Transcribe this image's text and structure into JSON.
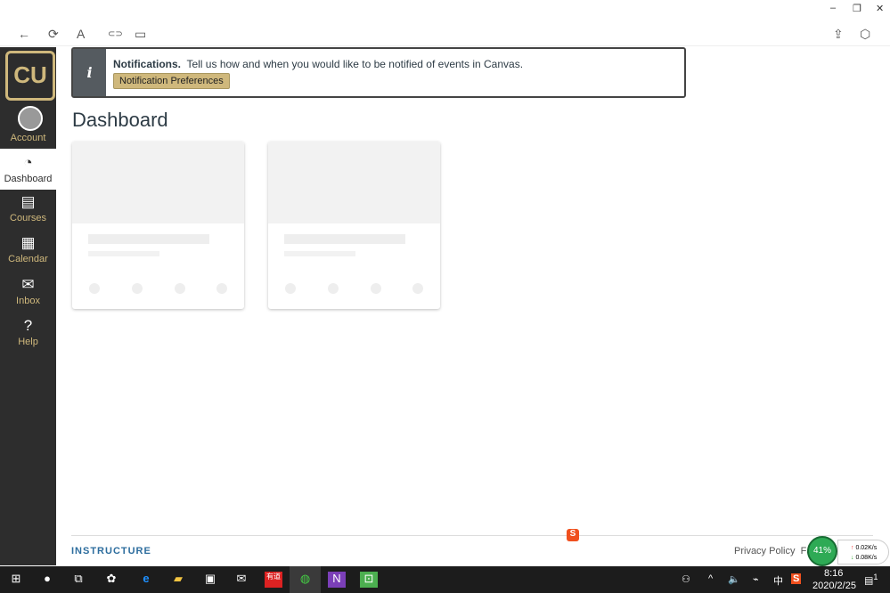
{
  "window": {
    "minimize": "–",
    "restore": "❐",
    "close": "✕"
  },
  "toolbar": {
    "back": "←",
    "refresh": "⟳",
    "read": "A",
    "link": "⊂⊃",
    "panel": "▭",
    "share": "⇪",
    "cube": "⬡"
  },
  "sidebar": {
    "logo": "CU",
    "account": "Account",
    "items": [
      {
        "label": "Dashboard",
        "icon": "◔"
      },
      {
        "label": "Courses",
        "icon": "▤"
      },
      {
        "label": "Calendar",
        "icon": "▦"
      },
      {
        "label": "Inbox",
        "icon": "✉"
      },
      {
        "label": "Help",
        "icon": "?"
      }
    ]
  },
  "notification": {
    "title": "Notifications.",
    "text": "Tell us how and when you would like to be notified of events in Canvas.",
    "button": "Notification Preferences"
  },
  "page_title": "Dashboard",
  "footer": {
    "brand": "INSTRUCTURE",
    "privacy": "Privacy Policy",
    "facebook_partial": "Fa"
  },
  "widget": {
    "cpu": "41%",
    "up": "0.02K/s",
    "down": "0.08K/s"
  },
  "taskbar": {
    "time": "8:16",
    "date": "2020/2/25",
    "ime": "中",
    "notif_count": "1"
  }
}
